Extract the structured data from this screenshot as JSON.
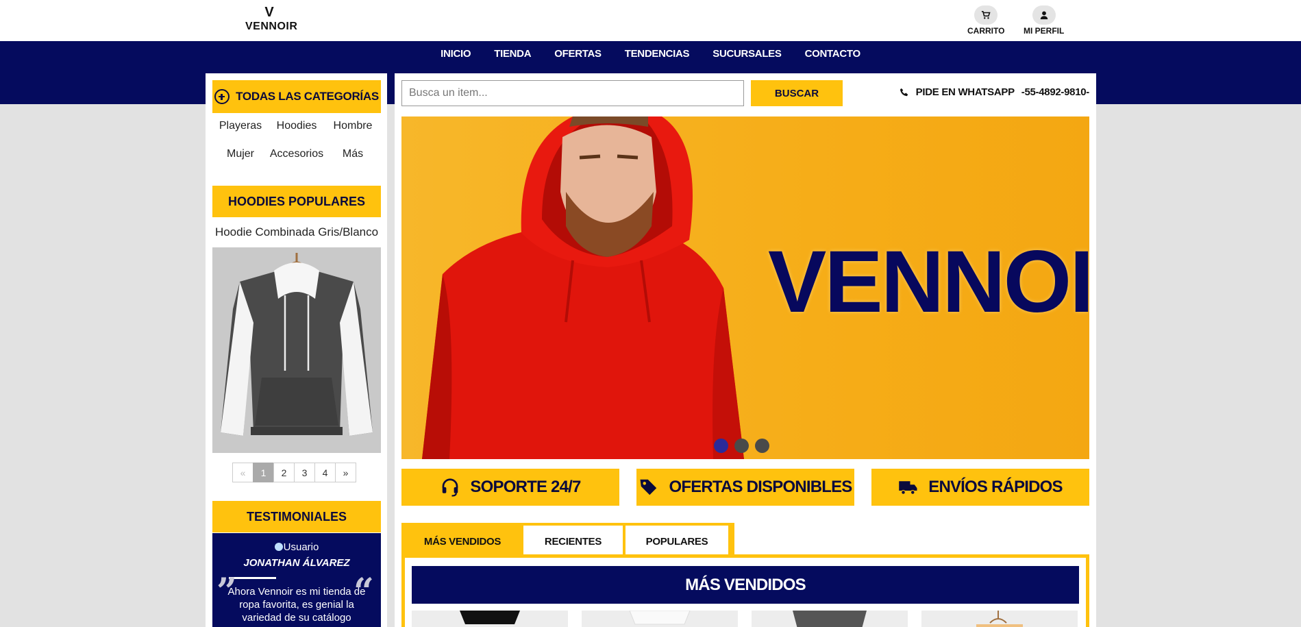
{
  "brand": {
    "logo_letter": "V",
    "logo_name": "VENNOIR"
  },
  "header": {
    "cart_label": "CARRITO",
    "profile_label": "MI PERFIL"
  },
  "nav": {
    "items": [
      "INICIO",
      "TIENDA",
      "OFERTAS",
      "TENDENCIAS",
      "SUCURSALES",
      "CONTACTO"
    ]
  },
  "sidebar": {
    "categories_title": "TODAS LAS CATEGORÍAS",
    "categories": [
      "Playeras",
      "Hoodies",
      "Hombre",
      "Mujer",
      "Accesorios",
      "Más"
    ],
    "popular_title": "HOODIES POPULARES",
    "popular_item": "Hoodie Combinada Gris/Blanco",
    "pagination": [
      "«",
      "1",
      "2",
      "3",
      "4",
      "»"
    ],
    "testimonials_title": "TESTIMONIALES",
    "testimonial": {
      "avatar_alt": "Usuario",
      "name": "JONATHAN ÁLVAREZ",
      "text": "Ahora Vennoir es mi tienda de ropa favorita, es genial la variedad de su catálogo"
    }
  },
  "search": {
    "placeholder": "Busca un item...",
    "button": "BUSCAR"
  },
  "whatsapp": {
    "label": "PIDE EN WHATSAPP",
    "number": "-55-4892-9810-"
  },
  "hero": {
    "brand_text": "VENNOIR",
    "slides": 3,
    "active_slide": 1
  },
  "features": [
    "SOPORTE 24/7",
    "OFERTAS DISPONIBLES",
    "ENVÍOS RÁPIDOS"
  ],
  "tabs": {
    "items": [
      "MÁS VENDIDOS",
      "RECIENTES",
      "POPULARES"
    ],
    "active": "MÁS VENDIDOS"
  },
  "panel": {
    "title": "MÁS VENDIDOS"
  },
  "colors": {
    "navy": "#050b5e",
    "yellow": "#ffc20e",
    "background": "#e2e2e2"
  }
}
